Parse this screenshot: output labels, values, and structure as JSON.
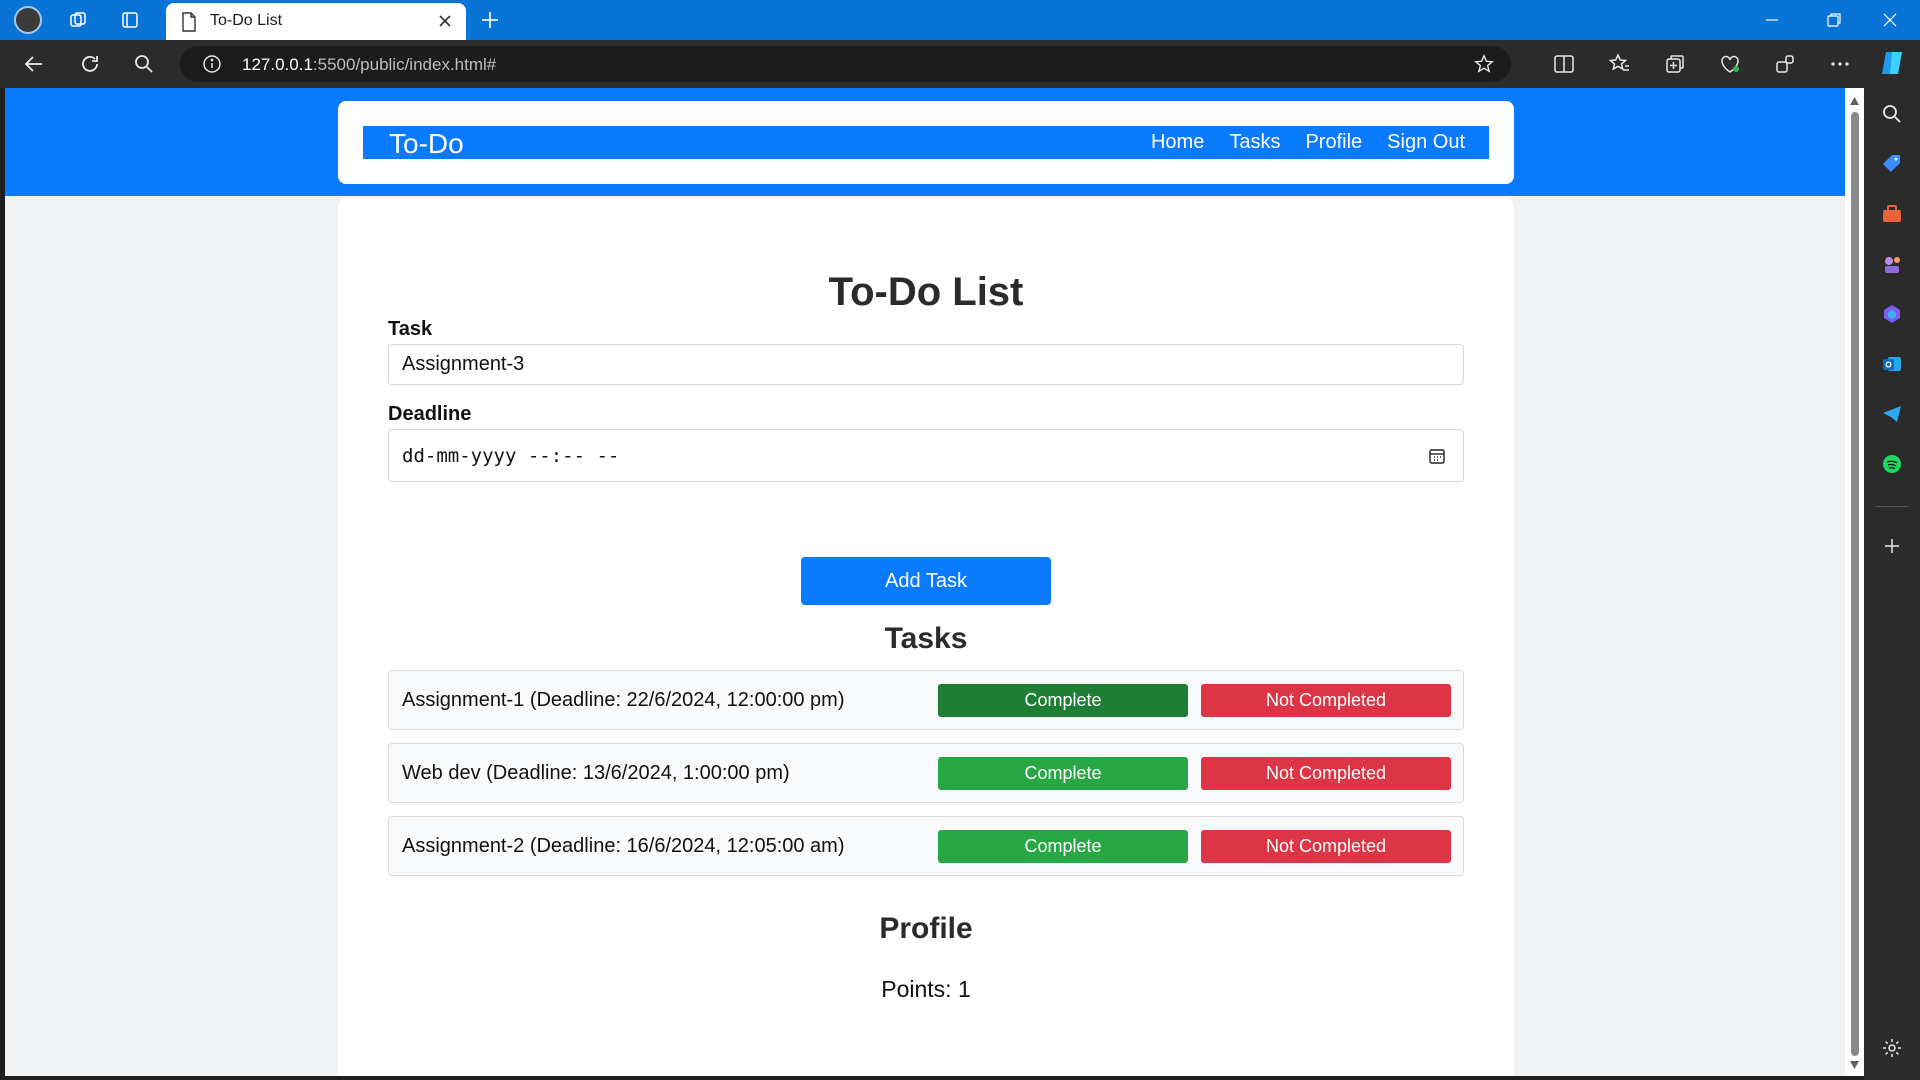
{
  "browser": {
    "tab_title": "To-Do List",
    "url_host": "127.0.0.1",
    "url_path": ":5500/public/index.html#",
    "accent_color": "#0a74d6"
  },
  "app": {
    "brand": "To-Do",
    "nav": [
      {
        "label": "Home"
      },
      {
        "label": "Tasks"
      },
      {
        "label": "Profile"
      },
      {
        "label": "Sign Out"
      }
    ],
    "primary_color": "#0a7bff"
  },
  "form": {
    "title": "To-Do List",
    "task_label": "Task",
    "task_value": "Assignment-3",
    "deadline_label": "Deadline",
    "deadline_placeholder": "dd-mm-yyyy --:-- --",
    "add_button": "Add Task"
  },
  "tasks": {
    "title": "Tasks",
    "items": [
      {
        "text": "Assignment-1 (Deadline: 22/6/2024, 12:00:00 pm)",
        "complete_label": "Complete",
        "not_completed_label": "Not Completed",
        "complete_color": "#1e7e34"
      },
      {
        "text": "Web dev (Deadline: 13/6/2024, 1:00:00 pm)",
        "complete_label": "Complete",
        "not_completed_label": "Not Completed",
        "complete_color": "#28a745"
      },
      {
        "text": "Assignment-2 (Deadline: 16/6/2024, 12:05:00 am)",
        "complete_label": "Complete",
        "not_completed_label": "Not Completed",
        "complete_color": "#28a745"
      }
    ]
  },
  "profile": {
    "title": "Profile",
    "points_text": "Points: 1"
  }
}
